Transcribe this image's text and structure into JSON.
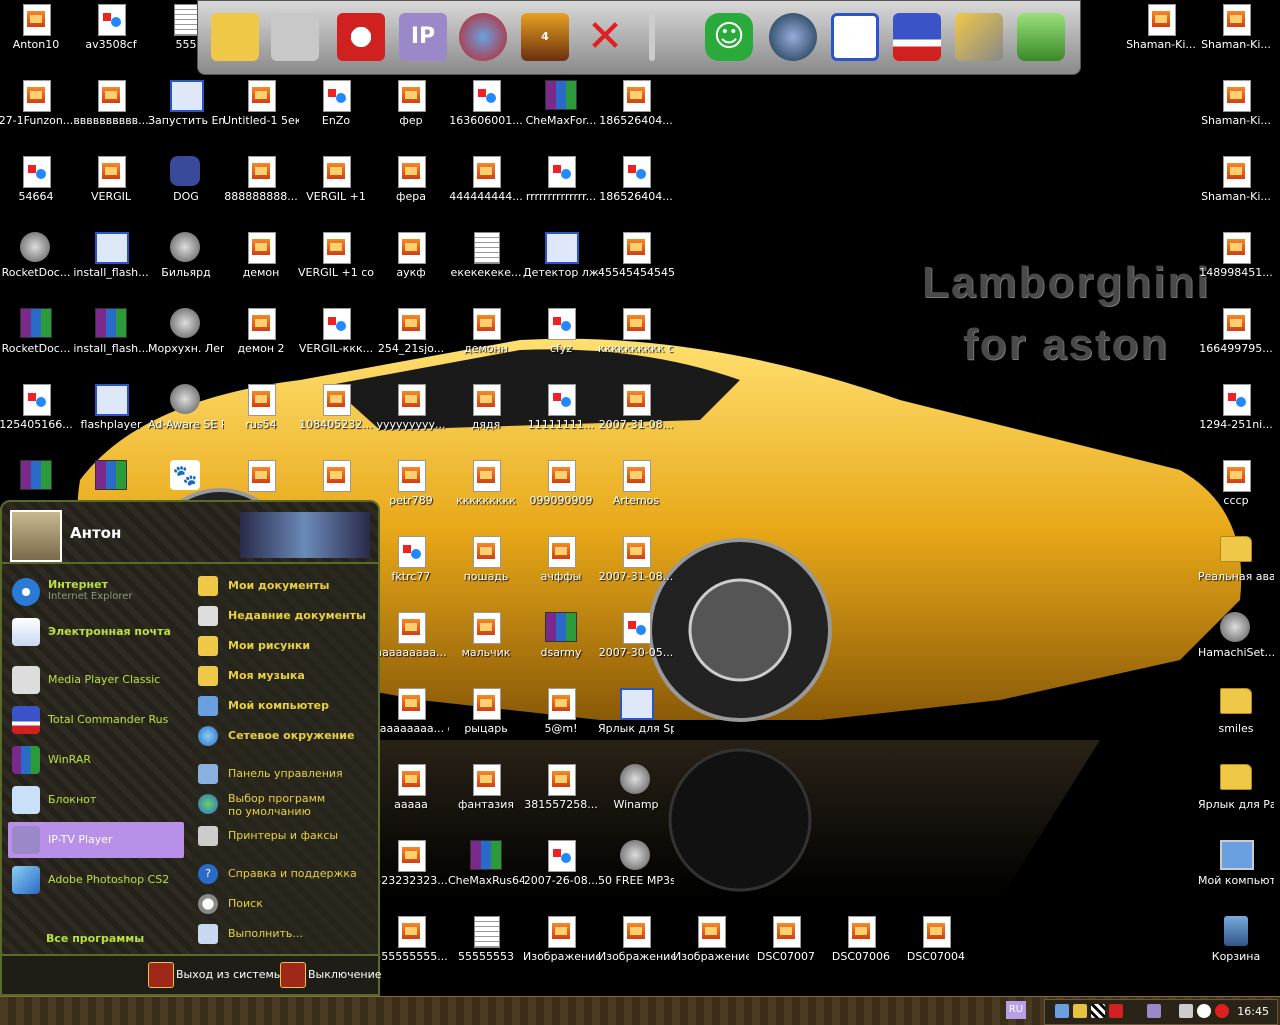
{
  "wallpaper": {
    "line1": "Lamborghini",
    "line2": "for aston"
  },
  "toolbar": {
    "items": [
      "folder-icon",
      "open-folder-icon",
      "santa-icon",
      "ip-tv-icon",
      "mouse-icon",
      "hyper-icon",
      "close-x-icon",
      "divider",
      "smile-icon",
      "winamp-icon",
      "window-icon",
      "floppy-icon",
      "tools-icon",
      "recycle-icon"
    ]
  },
  "desktop": {
    "icons": [
      {
        "label": "Anton10",
        "type": "img"
      },
      {
        "label": "av3508cf",
        "type": "jpg"
      },
      {
        "label": "555",
        "type": "doc"
      },
      {
        "label": "27-1Funzon...",
        "type": "img"
      },
      {
        "label": "вввввввввв...",
        "type": "img"
      },
      {
        "label": "Запустить Empire Ea...",
        "type": "app"
      },
      {
        "label": "Untitled-1 5еке44",
        "type": "img"
      },
      {
        "label": "EnZo",
        "type": "jpg"
      },
      {
        "label": "фер",
        "type": "img"
      },
      {
        "label": "163606001...",
        "type": "jpg"
      },
      {
        "label": "CheMaxFor...",
        "type": "rar"
      },
      {
        "label": "186526404...",
        "type": "img"
      },
      {
        "label": "54664",
        "type": "jpg"
      },
      {
        "label": "VERGIL",
        "type": "img"
      },
      {
        "label": "DOG",
        "type": "dog"
      },
      {
        "label": "888888888...",
        "type": "img"
      },
      {
        "label": "VERGIL +1",
        "type": "img"
      },
      {
        "label": "фера",
        "type": "img"
      },
      {
        "label": "444444444...",
        "type": "img"
      },
      {
        "label": "rrrrrrrrrrrrrr...",
        "type": "jpg"
      },
      {
        "label": "186526404...",
        "type": "jpg"
      },
      {
        "label": "RocketDoc...",
        "type": "round"
      },
      {
        "label": "install_flash...",
        "type": "app"
      },
      {
        "label": "Бильярд",
        "type": "round"
      },
      {
        "label": "демон",
        "type": "img"
      },
      {
        "label": "VERGIL +1 copy",
        "type": "img"
      },
      {
        "label": "аукф",
        "type": "img"
      },
      {
        "label": "екекекеке...",
        "type": "doc"
      },
      {
        "label": "Детектор лжи",
        "type": "app"
      },
      {
        "label": "45545454545",
        "type": "img"
      },
      {
        "label": "RocketDoc...",
        "type": "rar"
      },
      {
        "label": "install_flash...",
        "type": "rar"
      },
      {
        "label": "Морхухн. Леген...",
        "type": "round"
      },
      {
        "label": "демон 2",
        "type": "img"
      },
      {
        "label": "VERGIL-ккк...",
        "type": "jpg"
      },
      {
        "label": "254_21sjo...",
        "type": "img"
      },
      {
        "label": "демонн",
        "type": "img"
      },
      {
        "label": "cfyz",
        "type": "jpg"
      },
      {
        "label": "кккккккккк copy",
        "type": "img"
      },
      {
        "label": "125405166...",
        "type": "jpg"
      },
      {
        "label": "flashplayer",
        "type": "app"
      },
      {
        "label": "Ad-Aware SE Personal",
        "type": "round"
      },
      {
        "label": "rus54",
        "type": "img"
      },
      {
        "label": "108405232...",
        "type": "img"
      },
      {
        "label": "ууууууууу...",
        "type": "img"
      },
      {
        "label": "дядя",
        "type": "img"
      },
      {
        "label": "11111111...",
        "type": "jpg"
      },
      {
        "label": "2007-31-08...",
        "type": "img"
      },
      {
        "label": "",
        "type": "rar"
      },
      {
        "label": "",
        "type": "rar"
      },
      {
        "label": "",
        "type": "paw"
      },
      {
        "label": "",
        "type": "img"
      },
      {
        "label": "",
        "type": "img"
      },
      {
        "label": "petr789",
        "type": "img"
      },
      {
        "label": "ккккккккк",
        "type": "img"
      },
      {
        "label": "099090909",
        "type": "img"
      },
      {
        "label": "Artemos",
        "type": "img"
      },
      {
        "label": "fktrc77",
        "type": "jpg"
      },
      {
        "label": "пошадь",
        "type": "img"
      },
      {
        "label": "ачффы",
        "type": "img"
      },
      {
        "label": "2007-31-08...",
        "type": "img"
      },
      {
        "label": "ааааааааа...",
        "type": "img"
      },
      {
        "label": "мальчик",
        "type": "img"
      },
      {
        "label": "dsarmy",
        "type": "rar"
      },
      {
        "label": "2007-30-05...",
        "type": "jpg"
      },
      {
        "label": "ааааааааа... copy",
        "type": "img"
      },
      {
        "label": "рыцарь",
        "type": "img"
      },
      {
        "label": "5@m!",
        "type": "img"
      },
      {
        "label": "Ярлык для Spider",
        "type": "app"
      },
      {
        "label": "ааааа",
        "type": "img"
      },
      {
        "label": "фантазия",
        "type": "img"
      },
      {
        "label": "381557258...",
        "type": "img"
      },
      {
        "label": "Winamp",
        "type": "round"
      },
      {
        "label": "323232323...",
        "type": "img"
      },
      {
        "label": "CheMaxRus64",
        "type": "rar"
      },
      {
        "label": "2007-26-08...",
        "type": "jpg"
      },
      {
        "label": "50 FREE MP3s from eMusic!",
        "type": "round"
      },
      {
        "label": "555555555...",
        "type": "img"
      },
      {
        "label": "55555553",
        "type": "doc"
      },
      {
        "label": "Изображение 006",
        "type": "img"
      },
      {
        "label": "Изображение 007",
        "type": "img"
      },
      {
        "label": "Изображение",
        "type": "img"
      },
      {
        "label": "DSC07007",
        "type": "img"
      },
      {
        "label": "DSC07006",
        "type": "img"
      },
      {
        "label": "DSC07004",
        "type": "img"
      },
      {
        "label": "Shaman-Ki...",
        "type": "img"
      },
      {
        "label": "Shaman-Ki...",
        "type": "img"
      },
      {
        "label": "Shaman-Ki...",
        "type": "img"
      },
      {
        "label": "Shaman-Ki...",
        "type": "img"
      },
      {
        "label": "148998451...",
        "type": "img"
      },
      {
        "label": "166499795...",
        "type": "img"
      },
      {
        "label": "1294-251ni...",
        "type": "jpg"
      },
      {
        "label": "сссp",
        "type": "img"
      },
      {
        "label": "Реальная ава",
        "type": "folder"
      },
      {
        "label": "HamachiSet...",
        "type": "round"
      },
      {
        "label": "smiles",
        "type": "folder"
      },
      {
        "label": "Ярлык для Рабочий стол",
        "type": "folder"
      },
      {
        "label": "Мой компьютер",
        "type": "pc"
      },
      {
        "label": "Корзина",
        "type": "trash"
      }
    ]
  },
  "startmenu": {
    "user": "Антон",
    "pinned": [
      {
        "title": "Интернет",
        "subtitle": "Internet Explorer"
      },
      {
        "title": "Электронная почта",
        "subtitle": ""
      }
    ],
    "recent": [
      "Media Player Classic",
      "Total Commander Rus",
      "WinRAR",
      "Блокнот",
      "IP-TV Player",
      "Adobe Photoshop CS2"
    ],
    "all_programs": "Все программы",
    "right": [
      "Мои документы",
      "Недавние документы",
      "Мои рисунки",
      "Моя музыка",
      "Мой компьютер",
      "Сетевое окружение",
      "Панель управления",
      "Выбор программ по умолчанию",
      "Принтеры и факсы",
      "Справка и поддержка",
      "Поиск",
      "Выполнить..."
    ],
    "logoff": "Выход из системы",
    "shutdown": "Выключение"
  },
  "taskbar": {
    "lang": "RU",
    "clock": "16:45"
  }
}
